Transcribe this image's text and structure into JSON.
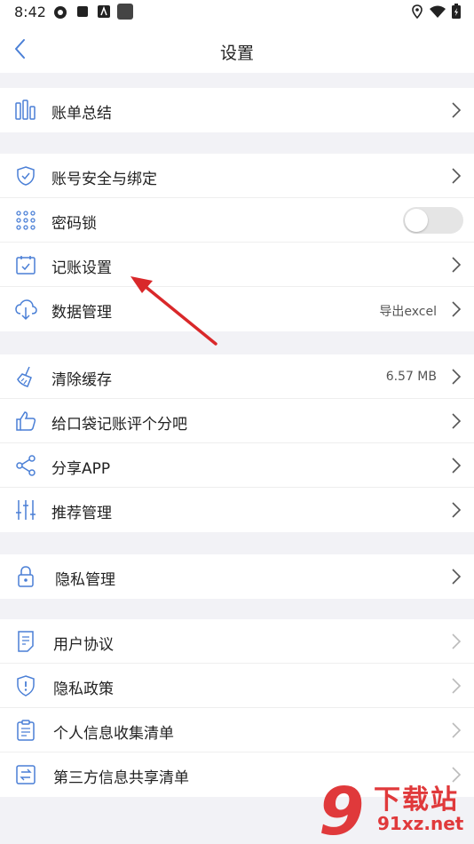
{
  "status_bar": {
    "time": "8:42"
  },
  "header": {
    "title": "设置",
    "back_icon": "chevron-left-icon"
  },
  "groups": [
    {
      "items": [
        {
          "label": "账单总结",
          "icon": "bar-chart-icon"
        }
      ]
    },
    {
      "items": [
        {
          "label": "账号安全与绑定",
          "icon": "shield-check-icon"
        },
        {
          "label": "密码锁",
          "icon": "keypad-icon",
          "toggle": false
        },
        {
          "label": "记账设置",
          "icon": "calendar-check-icon"
        },
        {
          "label": "数据管理",
          "icon": "cloud-download-icon",
          "value": "导出excel"
        }
      ]
    },
    {
      "items": [
        {
          "label": "清除缓存",
          "icon": "broom-icon",
          "value": "6.57 MB"
        },
        {
          "label": "给口袋记账评个分吧",
          "icon": "thumbs-up-icon"
        },
        {
          "label": "分享APP",
          "icon": "share-icon"
        },
        {
          "label": "推荐管理",
          "icon": "sliders-icon"
        }
      ]
    },
    {
      "items": [
        {
          "label": "隐私管理",
          "icon": "lock-icon"
        }
      ]
    },
    {
      "items": [
        {
          "label": "用户协议",
          "icon": "document-icon"
        },
        {
          "label": "隐私政策",
          "icon": "shield-alert-icon"
        },
        {
          "label": "个人信息收集清单",
          "icon": "clipboard-icon"
        },
        {
          "label": "第三方信息共享清单",
          "icon": "exchange-icon"
        }
      ]
    }
  ],
  "colors": {
    "accent": "#4a7fd6",
    "annotation": "#d9282a"
  },
  "watermark": {
    "big": "下载站",
    "small": "91xz.net",
    "logo_numeral": "9"
  }
}
